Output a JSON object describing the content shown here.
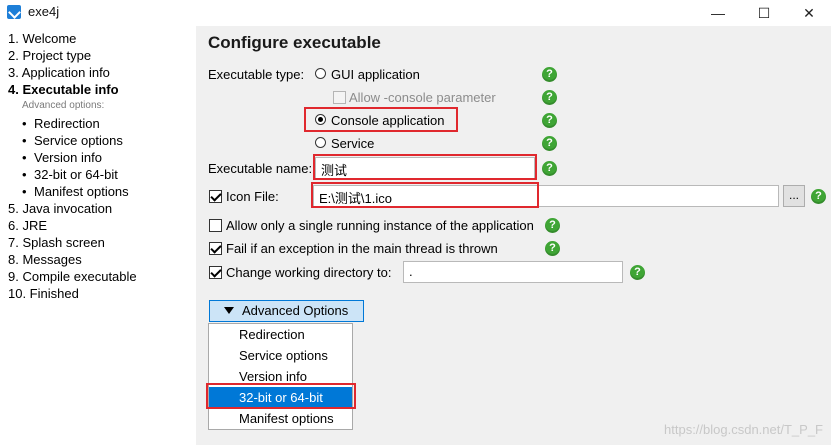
{
  "window": {
    "title": "exe4j"
  },
  "nav": {
    "items": [
      {
        "label": "1. Welcome"
      },
      {
        "label": "2. Project type"
      },
      {
        "label": "3. Application info"
      },
      {
        "label": "4. Executable info"
      },
      {
        "label": "5. Java invocation"
      },
      {
        "label": "6. JRE"
      },
      {
        "label": "7. Splash screen"
      },
      {
        "label": "8. Messages"
      },
      {
        "label": "9. Compile executable"
      },
      {
        "label": "10. Finished"
      }
    ],
    "sub_label": "Advanced options:",
    "sub_items": [
      {
        "label": "Redirection"
      },
      {
        "label": "Service options"
      },
      {
        "label": "Version info"
      },
      {
        "label": "32-bit or 64-bit"
      },
      {
        "label": "Manifest options"
      }
    ]
  },
  "main": {
    "heading": "Configure executable",
    "exe_type_label": "Executable type:",
    "gui_app": "GUI application",
    "allow_console": "Allow -console parameter",
    "console_app": "Console application",
    "service": "Service",
    "exe_name_label": "Executable name:",
    "exe_name_value": "测试",
    "icon_file_label": "Icon File:",
    "icon_file_value": "E:\\测试\\1.ico",
    "browse_label": "...",
    "single_instance": "Allow only a single running instance of the application",
    "fail_exception": "Fail if an exception in the main thread is thrown",
    "change_dir": "Change working directory to:",
    "change_dir_value": ".",
    "help_glyph": "?"
  },
  "advanced": {
    "button_label": "Advanced Options",
    "items": [
      {
        "label": "Redirection"
      },
      {
        "label": "Service options"
      },
      {
        "label": "Version info"
      },
      {
        "label": "32-bit or 64-bit"
      },
      {
        "label": "Manifest options"
      }
    ],
    "selected_index": 3
  },
  "watermark": "https://blog.csdn.net/T_P_F",
  "colors": {
    "accent": "#0078d7",
    "highlight_red": "#e0282e",
    "help_green": "#3fa535"
  }
}
